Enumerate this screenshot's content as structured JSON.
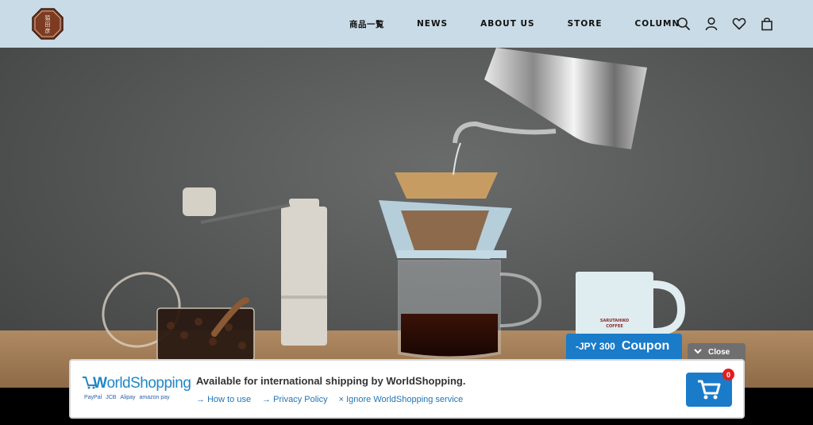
{
  "header": {
    "logo": {
      "icon": "shop-logo-seal",
      "text": "猿田彦"
    },
    "nav": [
      {
        "label": "商品一覧"
      },
      {
        "label": "NEWS"
      },
      {
        "label": "ABOUT US"
      },
      {
        "label": "STORE"
      },
      {
        "label": "COLUMN"
      }
    ],
    "icons": [
      "search-icon",
      "account-icon",
      "heart-icon",
      "bag-icon"
    ],
    "background_color": "#c9dbe6"
  },
  "hero": {
    "mug_text": "SARUTAHIKO\nCOFFEE",
    "mug_text_line1": "SARUTAHIKO",
    "mug_text_line2": "COFFEE"
  },
  "worldshopping": {
    "logo": "WorldShopping",
    "logo_prefix": "W",
    "logo_rest": "orldShopping",
    "payments": [
      "PayPal",
      "JCB",
      "Alipay",
      "amazon pay"
    ],
    "message": "Available for international shipping by WorldShopping.",
    "links": [
      {
        "label": "How to use",
        "icon": "arrow-right-icon"
      },
      {
        "label": "Privacy Policy",
        "icon": "arrow-right-icon"
      },
      {
        "label": "Ignore WorldShopping service",
        "icon": "x-icon"
      }
    ],
    "coupon": {
      "amount": "-JPY 300",
      "label": "Coupon"
    },
    "close": {
      "label": "Close"
    },
    "cart": {
      "count": "0"
    },
    "brand_color": "#1a7bc9"
  }
}
